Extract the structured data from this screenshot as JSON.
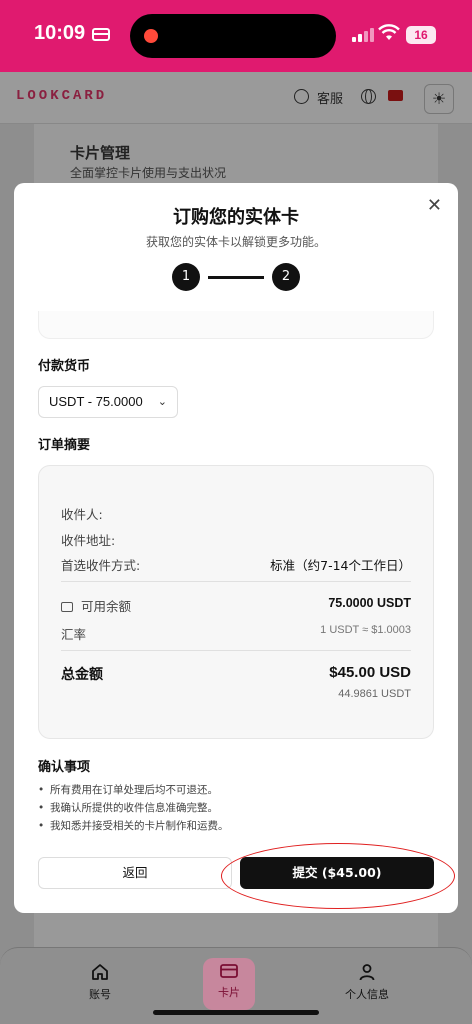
{
  "status_bar": {
    "time": "10:09",
    "battery": "16"
  },
  "header": {
    "logo": "LOOKCARD",
    "support_label": "客服"
  },
  "background_page": {
    "title": "卡片管理",
    "subtitle": "全面掌控卡片使用与支出状况"
  },
  "modal": {
    "title": "订购您的实体卡",
    "subtitle": "获取您的实体卡以解锁更多功能。",
    "steps": [
      "1",
      "2"
    ],
    "payment_currency": {
      "label": "付款货币",
      "selected": "USDT - 75.0000"
    },
    "order_summary": {
      "label": "订单摘要",
      "recipient_label": "收件人:",
      "address_label": "收件地址:",
      "shipping_label": "首选收件方式:",
      "shipping_value": "标准（约7-14个工作日）",
      "balance_label": "可用余额",
      "balance_value": "75.0000 USDT",
      "rate_label": "汇率",
      "rate_value": "1 USDT ≈ $1.0003",
      "total_label": "总金额",
      "total_value": "$45.00 USD",
      "total_usdt": "44.9861 USDT"
    },
    "confirmations": {
      "title": "确认事项",
      "items": [
        "所有费用在订单处理后均不可退还。",
        "我确认所提供的收件信息准确完整。",
        "我知悉并接受相关的卡片制作和运费。"
      ]
    },
    "back_label": "返回",
    "submit_label": "提交 ($45.00)"
  },
  "bottom_nav": {
    "items": [
      {
        "label": "账号",
        "icon": "home-icon"
      },
      {
        "label": "卡片",
        "icon": "card-icon"
      },
      {
        "label": "个人信息",
        "icon": "user-icon"
      }
    ]
  },
  "colors": {
    "accent": "#e01a6f",
    "highlight": "#e02020"
  }
}
